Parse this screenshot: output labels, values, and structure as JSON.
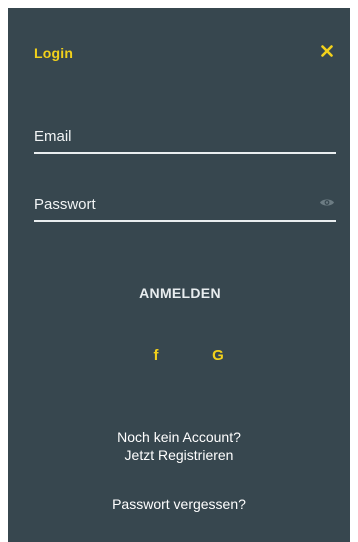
{
  "header": {
    "title": "Login",
    "close_icon": "close-icon"
  },
  "form": {
    "email_placeholder": "Email",
    "password_placeholder": "Passwort",
    "eye_icon": "eye-icon",
    "submit_label": "ANMELDEN"
  },
  "social": {
    "facebook_label": "f",
    "google_label": "G"
  },
  "links": {
    "no_account": "Noch kein Account?",
    "register": "Jetzt Registrieren",
    "forgot_password": "Passwort vergessen?"
  },
  "colors": {
    "panel_bg": "#37474f",
    "accent": "#f2d11b",
    "text": "#ffffff"
  }
}
